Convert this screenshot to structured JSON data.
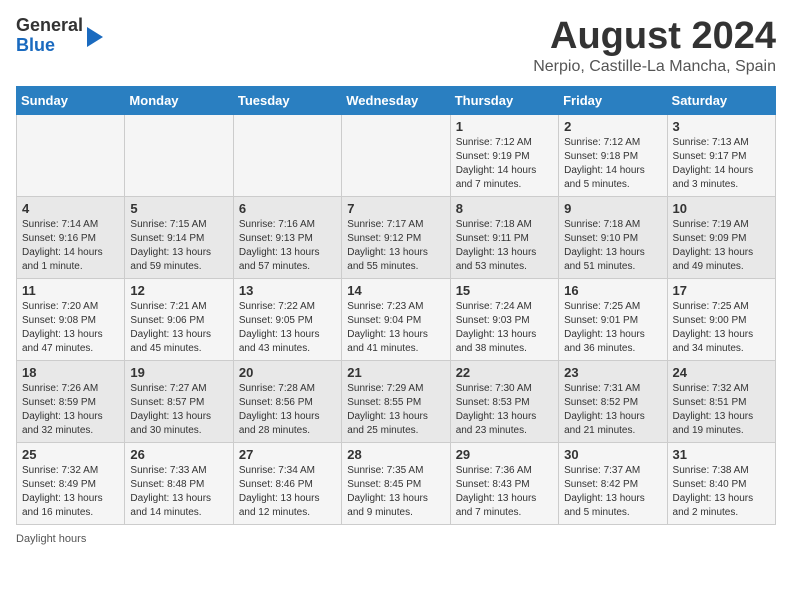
{
  "header": {
    "logo_general": "General",
    "logo_blue": "Blue",
    "main_title": "August 2024",
    "subtitle": "Nerpio, Castille-La Mancha, Spain"
  },
  "columns": [
    "Sunday",
    "Monday",
    "Tuesday",
    "Wednesday",
    "Thursday",
    "Friday",
    "Saturday"
  ],
  "weeks": [
    [
      {
        "day": "",
        "info": ""
      },
      {
        "day": "",
        "info": ""
      },
      {
        "day": "",
        "info": ""
      },
      {
        "day": "",
        "info": ""
      },
      {
        "day": "1",
        "info": "Sunrise: 7:12 AM\nSunset: 9:19 PM\nDaylight: 14 hours and 7 minutes."
      },
      {
        "day": "2",
        "info": "Sunrise: 7:12 AM\nSunset: 9:18 PM\nDaylight: 14 hours and 5 minutes."
      },
      {
        "day": "3",
        "info": "Sunrise: 7:13 AM\nSunset: 9:17 PM\nDaylight: 14 hours and 3 minutes."
      }
    ],
    [
      {
        "day": "4",
        "info": "Sunrise: 7:14 AM\nSunset: 9:16 PM\nDaylight: 14 hours and 1 minute."
      },
      {
        "day": "5",
        "info": "Sunrise: 7:15 AM\nSunset: 9:14 PM\nDaylight: 13 hours and 59 minutes."
      },
      {
        "day": "6",
        "info": "Sunrise: 7:16 AM\nSunset: 9:13 PM\nDaylight: 13 hours and 57 minutes."
      },
      {
        "day": "7",
        "info": "Sunrise: 7:17 AM\nSunset: 9:12 PM\nDaylight: 13 hours and 55 minutes."
      },
      {
        "day": "8",
        "info": "Sunrise: 7:18 AM\nSunset: 9:11 PM\nDaylight: 13 hours and 53 minutes."
      },
      {
        "day": "9",
        "info": "Sunrise: 7:18 AM\nSunset: 9:10 PM\nDaylight: 13 hours and 51 minutes."
      },
      {
        "day": "10",
        "info": "Sunrise: 7:19 AM\nSunset: 9:09 PM\nDaylight: 13 hours and 49 minutes."
      }
    ],
    [
      {
        "day": "11",
        "info": "Sunrise: 7:20 AM\nSunset: 9:08 PM\nDaylight: 13 hours and 47 minutes."
      },
      {
        "day": "12",
        "info": "Sunrise: 7:21 AM\nSunset: 9:06 PM\nDaylight: 13 hours and 45 minutes."
      },
      {
        "day": "13",
        "info": "Sunrise: 7:22 AM\nSunset: 9:05 PM\nDaylight: 13 hours and 43 minutes."
      },
      {
        "day": "14",
        "info": "Sunrise: 7:23 AM\nSunset: 9:04 PM\nDaylight: 13 hours and 41 minutes."
      },
      {
        "day": "15",
        "info": "Sunrise: 7:24 AM\nSunset: 9:03 PM\nDaylight: 13 hours and 38 minutes."
      },
      {
        "day": "16",
        "info": "Sunrise: 7:25 AM\nSunset: 9:01 PM\nDaylight: 13 hours and 36 minutes."
      },
      {
        "day": "17",
        "info": "Sunrise: 7:25 AM\nSunset: 9:00 PM\nDaylight: 13 hours and 34 minutes."
      }
    ],
    [
      {
        "day": "18",
        "info": "Sunrise: 7:26 AM\nSunset: 8:59 PM\nDaylight: 13 hours and 32 minutes."
      },
      {
        "day": "19",
        "info": "Sunrise: 7:27 AM\nSunset: 8:57 PM\nDaylight: 13 hours and 30 minutes."
      },
      {
        "day": "20",
        "info": "Sunrise: 7:28 AM\nSunset: 8:56 PM\nDaylight: 13 hours and 28 minutes."
      },
      {
        "day": "21",
        "info": "Sunrise: 7:29 AM\nSunset: 8:55 PM\nDaylight: 13 hours and 25 minutes."
      },
      {
        "day": "22",
        "info": "Sunrise: 7:30 AM\nSunset: 8:53 PM\nDaylight: 13 hours and 23 minutes."
      },
      {
        "day": "23",
        "info": "Sunrise: 7:31 AM\nSunset: 8:52 PM\nDaylight: 13 hours and 21 minutes."
      },
      {
        "day": "24",
        "info": "Sunrise: 7:32 AM\nSunset: 8:51 PM\nDaylight: 13 hours and 19 minutes."
      }
    ],
    [
      {
        "day": "25",
        "info": "Sunrise: 7:32 AM\nSunset: 8:49 PM\nDaylight: 13 hours and 16 minutes."
      },
      {
        "day": "26",
        "info": "Sunrise: 7:33 AM\nSunset: 8:48 PM\nDaylight: 13 hours and 14 minutes."
      },
      {
        "day": "27",
        "info": "Sunrise: 7:34 AM\nSunset: 8:46 PM\nDaylight: 13 hours and 12 minutes."
      },
      {
        "day": "28",
        "info": "Sunrise: 7:35 AM\nSunset: 8:45 PM\nDaylight: 13 hours and 9 minutes."
      },
      {
        "day": "29",
        "info": "Sunrise: 7:36 AM\nSunset: 8:43 PM\nDaylight: 13 hours and 7 minutes."
      },
      {
        "day": "30",
        "info": "Sunrise: 7:37 AM\nSunset: 8:42 PM\nDaylight: 13 hours and 5 minutes."
      },
      {
        "day": "31",
        "info": "Sunrise: 7:38 AM\nSunset: 8:40 PM\nDaylight: 13 hours and 2 minutes."
      }
    ]
  ],
  "footer": {
    "note": "Daylight hours"
  }
}
